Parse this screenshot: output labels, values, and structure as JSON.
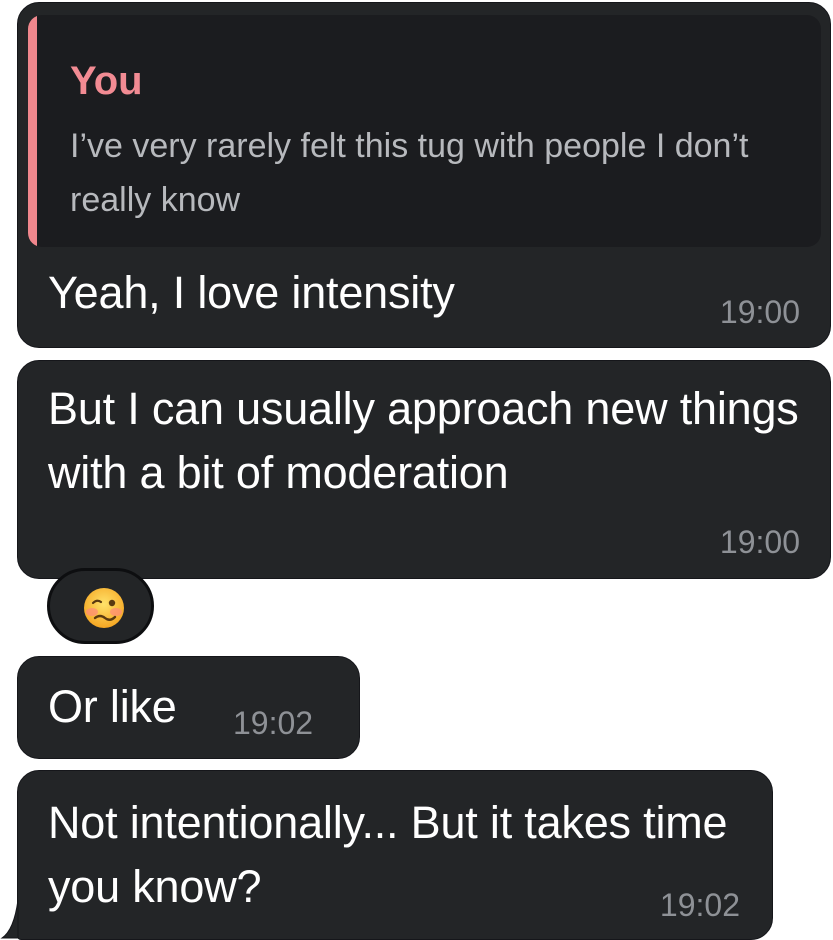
{
  "messages": [
    {
      "reply": {
        "author": "You",
        "text": "I’ve very rarely felt this tug with people I don’t really know"
      },
      "text": "Yeah, I love intensity",
      "time": "19:00"
    },
    {
      "text": "But I can usually approach new things with a bit of moderation",
      "time": "19:00",
      "reaction": {
        "icon": "woozy-face-emoji"
      }
    },
    {
      "text": "Or like",
      "time": "19:02"
    },
    {
      "text": "Not intentionally... But it takes time you know?",
      "time": "19:02"
    }
  ],
  "colors": {
    "bubble": "#232527",
    "quote_background": "#1b1c1f",
    "quote_accent": "#f0878d",
    "timestamp": "#8e9196"
  }
}
